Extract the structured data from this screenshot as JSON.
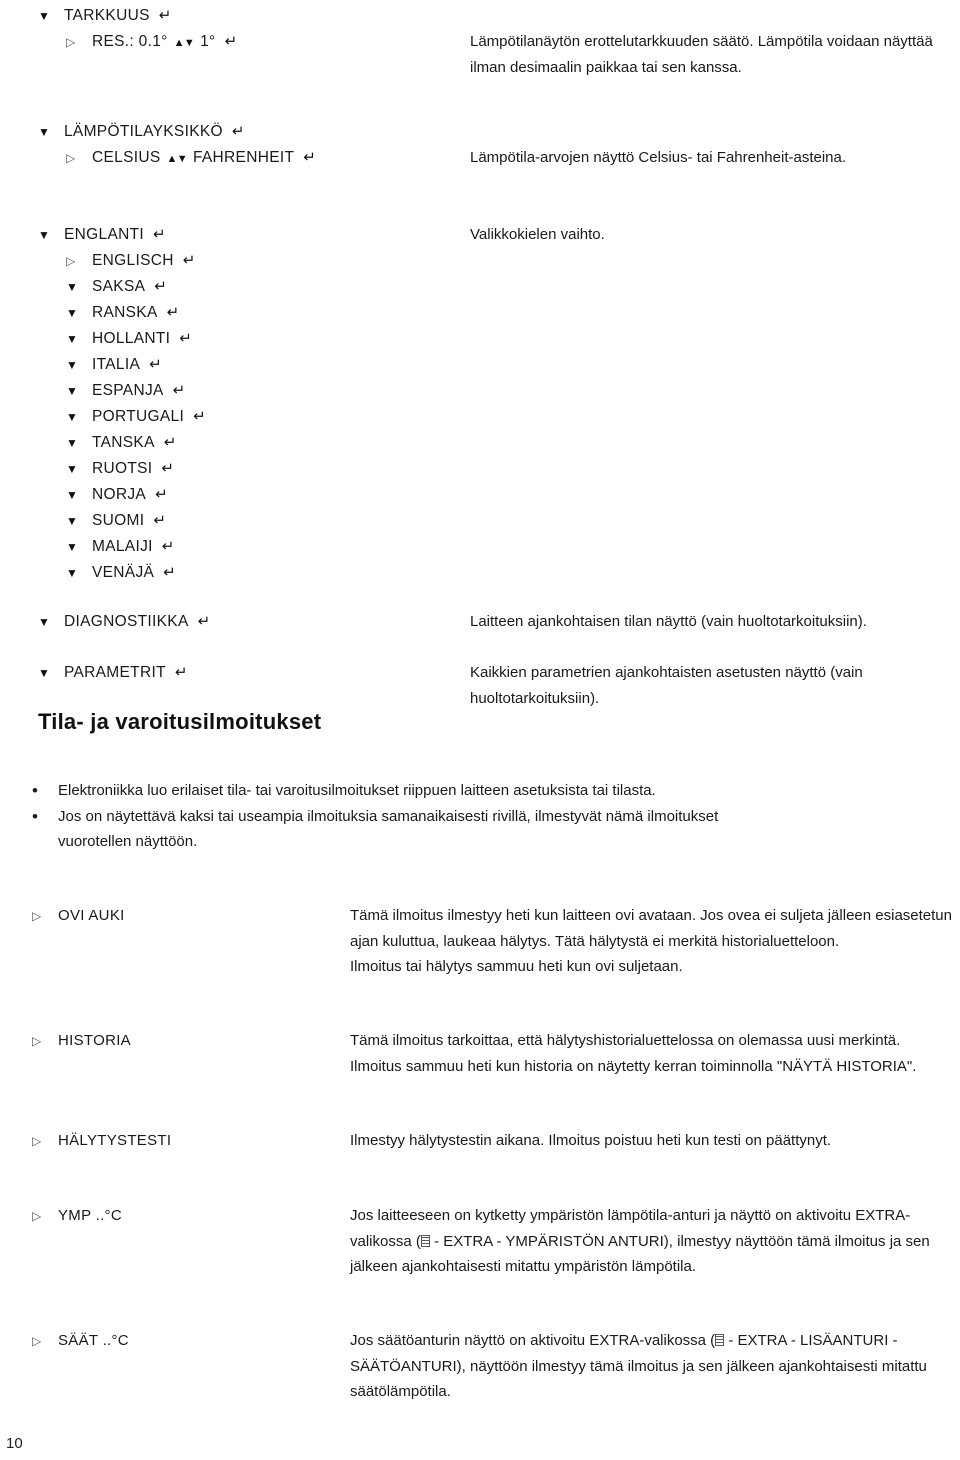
{
  "page": {
    "number": "10"
  },
  "menu_rows": [
    {
      "indent": 0,
      "marker": "▼",
      "marker_type": "tri-down",
      "label": "TARKKUUS",
      "enter": "↵",
      "desc": ""
    },
    {
      "indent": 1,
      "marker": "▷",
      "marker_type": "tri-right",
      "label": "RES.: 0.1°",
      "updown": "▲▼",
      "label2": "1°",
      "enter": "↵",
      "desc": "Lämpötilanäytön erottelutarkkuuden säätö. Lämpötila voidaan näyttää ilman desimaalin paikkaa tai sen kanssa."
    },
    {
      "indent": 0,
      "marker": "▼",
      "marker_type": "tri-down",
      "label": "LÄMPÖTILAYKSIKKÖ",
      "enter": "↵",
      "desc": ""
    },
    {
      "indent": 1,
      "marker": "▷",
      "marker_type": "tri-right",
      "label": "CELSIUS",
      "updown": "▲▼",
      "label2": "FAHRENHEIT",
      "enter": "↵",
      "desc": "Lämpötila-arvojen näyttö Celsius- tai Fahrenheit-asteina."
    },
    {
      "indent": 0,
      "marker": "▼",
      "marker_type": "tri-down",
      "label": "ENGLANTI",
      "enter": "↵",
      "desc": "Valikkokielen vaihto."
    },
    {
      "indent": 1,
      "marker": "▷",
      "marker_type": "tri-right",
      "label": "ENGLISCH",
      "enter": "↵",
      "desc": ""
    },
    {
      "indent": 1,
      "marker": "▼",
      "marker_type": "tri-down",
      "label": "SAKSA",
      "enter": "↵",
      "desc": ""
    },
    {
      "indent": 1,
      "marker": "▼",
      "marker_type": "tri-down",
      "label": "RANSKA",
      "enter": "↵",
      "desc": ""
    },
    {
      "indent": 1,
      "marker": "▼",
      "marker_type": "tri-down",
      "label": "HOLLANTI",
      "enter": "↵",
      "desc": ""
    },
    {
      "indent": 1,
      "marker": "▼",
      "marker_type": "tri-down",
      "label": "ITALIA",
      "enter": "↵",
      "desc": ""
    },
    {
      "indent": 1,
      "marker": "▼",
      "marker_type": "tri-down",
      "label": "ESPANJA",
      "enter": "↵",
      "desc": ""
    },
    {
      "indent": 1,
      "marker": "▼",
      "marker_type": "tri-down",
      "label": "PORTUGALI",
      "enter": "↵",
      "desc": ""
    },
    {
      "indent": 1,
      "marker": "▼",
      "marker_type": "tri-down",
      "label": "TANSKA",
      "enter": "↵",
      "desc": ""
    },
    {
      "indent": 1,
      "marker": "▼",
      "marker_type": "tri-down",
      "label": "RUOTSI",
      "enter": "↵",
      "desc": ""
    },
    {
      "indent": 1,
      "marker": "▼",
      "marker_type": "tri-down",
      "label": "NORJA",
      "enter": "↵",
      "desc": ""
    },
    {
      "indent": 1,
      "marker": "▼",
      "marker_type": "tri-down",
      "label": "SUOMI",
      "enter": "↵",
      "desc": ""
    },
    {
      "indent": 1,
      "marker": "▼",
      "marker_type": "tri-down",
      "label": "MALAIJI",
      "enter": "↵",
      "desc": ""
    },
    {
      "indent": 1,
      "marker": "▼",
      "marker_type": "tri-down",
      "label": "VENÄJÄ",
      "enter": "↵",
      "desc": ""
    }
  ],
  "diagnostics": {
    "rows": [
      {
        "marker": "▼",
        "label": "DIAGNOSTIIKKA",
        "enter": "↵",
        "desc": "Laitteen ajankohtaisen tilan näyttö (vain huoltotarkoituksiin)."
      },
      {
        "marker": "▼",
        "label": "PARAMETRIT",
        "enter": "↵",
        "desc": "Kaikkien parametrien ajankohtaisten asetusten näyttö (vain huoltotarkoituksiin)."
      }
    ]
  },
  "section": {
    "heading": "Tila- ja varoitusilmoitukset",
    "bullets": [
      "Elektroniikka luo erilaiset tila- tai varoitusilmoitukset riippuen laitteen asetuksista tai tilasta.",
      "Jos on näytettävä kaksi tai useampia ilmoituksia samanaikaisesti rivillä, ilmestyvät nämä ilmoitukset vuorotellen näyttöön."
    ]
  },
  "messages": [
    {
      "marker": "▷",
      "name": "OVI AUKI",
      "desc_parts": [
        {
          "type": "text",
          "value": "Tämä ilmoitus ilmestyy heti kun laitteen ovi avataan. Jos ovea ei suljeta jälleen esiasetetun ajan kuluttua, laukeaa hälytys. Tätä hälytystä ei merkitä historialuetteloon."
        },
        {
          "type": "break"
        },
        {
          "type": "text",
          "value": "Ilmoitus tai hälytys sammuu heti kun ovi suljetaan."
        }
      ]
    },
    {
      "marker": "▷",
      "name": "HISTORIA",
      "desc_parts": [
        {
          "type": "text",
          "value": "Tämä ilmoitus tarkoittaa, että hälytyshistorialuettelossa on olemassa uusi merkintä. Ilmoitus sammuu heti kun historia on näytetty kerran toiminnolla \"NÄYTÄ HISTORIA\"."
        }
      ]
    },
    {
      "marker": "▷",
      "name": "HÄLYTYSTESTI",
      "desc_parts": [
        {
          "type": "text",
          "value": "Ilmestyy hälytystestin aikana. Ilmoitus poistuu heti kun testi on päättynyt."
        }
      ]
    },
    {
      "marker": "▷",
      "name": "YMP ..°C",
      "desc_parts": [
        {
          "type": "text",
          "value": "Jos laitteeseen on kytketty ympäristön lämpötila-anturi ja näyttö on aktivoitu EXTRA-valikossa ("
        },
        {
          "type": "icon",
          "value": "menu-list-icon"
        },
        {
          "type": "text",
          "value": " - EXTRA - YMPÄRISTÖN ANTURI), ilmestyy näyttöön tämä ilmoitus ja sen jälkeen ajankohtaisesti mitattu ympäristön lämpötila."
        }
      ]
    },
    {
      "marker": "▷",
      "name": "SÄÄT ..°C",
      "desc_parts": [
        {
          "type": "text",
          "value": "Jos säätöanturin näyttö on aktivoitu EXTRA-valikossa ("
        },
        {
          "type": "icon",
          "value": "menu-list-icon"
        },
        {
          "type": "text",
          "value": " - EXTRA - LISÄANTURI - SÄÄTÖANTURI), näyttöön ilmestyy tämä ilmoitus ja sen jälkeen ajankohtaisesti mitattu säätölämpötila."
        }
      ]
    }
  ]
}
